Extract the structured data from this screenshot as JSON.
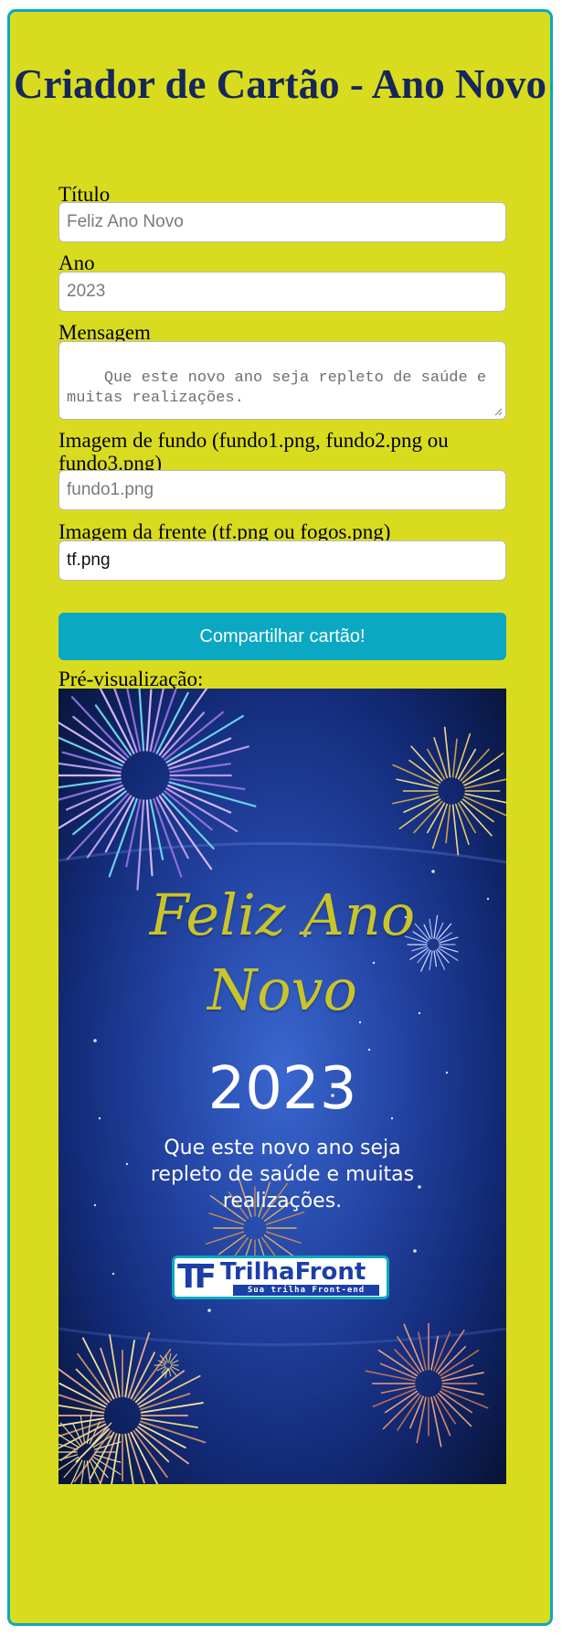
{
  "page": {
    "title": "Criador de Cartão - Ano Novo"
  },
  "form": {
    "titulo": {
      "label": "Título",
      "placeholder": "Feliz Ano Novo"
    },
    "ano": {
      "label": "Ano",
      "placeholder": "2023"
    },
    "mensagem": {
      "label": "Mensagem",
      "placeholder": "Que este novo ano seja repleto de saúde e muitas realizações."
    },
    "fundo": {
      "label": "Imagem de fundo (fundo1.png, fundo2.png ou fundo3.png)",
      "placeholder": "fundo1.png"
    },
    "frente": {
      "label": "Imagem da frente (tf.png ou fogos.png)",
      "value": "tf.png"
    },
    "submit_label": "Compartilhar cartão!"
  },
  "preview": {
    "label": "Pré-visualização:",
    "greeting_line1": "Feliz Ano",
    "greeting_line2": "Novo",
    "year": "2023",
    "message": "Que este novo ano seja repleto de saúde e muitas realizações.",
    "logo": {
      "mark": "TF",
      "name": "TrilhaFront",
      "tagline": "Sua trilha Front-end"
    }
  },
  "colors": {
    "page_background": "#d9dc1e",
    "accent": "#0aa8c2",
    "title_color": "#16275a",
    "script_gold": "#c9c42a"
  }
}
